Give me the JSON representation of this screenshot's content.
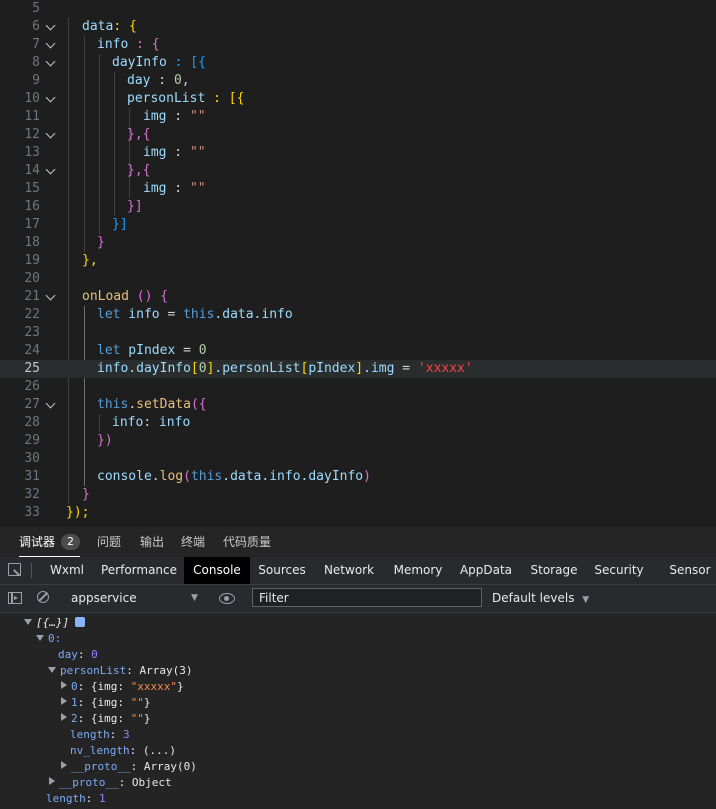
{
  "editor": {
    "lines": [
      {
        "n": "5"
      },
      {
        "n": "6"
      },
      {
        "n": "7"
      },
      {
        "n": "8"
      },
      {
        "n": "9"
      },
      {
        "n": "10"
      },
      {
        "n": "11"
      },
      {
        "n": "12"
      },
      {
        "n": "13"
      },
      {
        "n": "14"
      },
      {
        "n": "15"
      },
      {
        "n": "16"
      },
      {
        "n": "17"
      },
      {
        "n": "18"
      },
      {
        "n": "19"
      },
      {
        "n": "20"
      },
      {
        "n": "21"
      },
      {
        "n": "22"
      },
      {
        "n": "23"
      },
      {
        "n": "24"
      },
      {
        "n": "25"
      },
      {
        "n": "26"
      },
      {
        "n": "27"
      },
      {
        "n": "28"
      },
      {
        "n": "29"
      },
      {
        "n": "30"
      },
      {
        "n": "31"
      },
      {
        "n": "32"
      },
      {
        "n": "33"
      }
    ],
    "current_line": "25",
    "code": {
      "l6": [
        "data",
        ": {"
      ],
      "l7": [
        "info",
        " : {"
      ],
      "l8": [
        "dayInfo",
        " : [{"
      ],
      "l9": [
        "day",
        " : ",
        "0",
        ","
      ],
      "l10": [
        "personList",
        " : [{"
      ],
      "l11": [
        "img",
        " : ",
        "\"\""
      ],
      "l12": [
        "},{"
      ],
      "l13": [
        "img",
        " : ",
        "\"\""
      ],
      "l14": [
        "},{"
      ],
      "l15": [
        "img",
        " : ",
        "\"\""
      ],
      "l16": [
        "}]"
      ],
      "l17": [
        "}]"
      ],
      "l18": [
        "}"
      ],
      "l19": [
        "},"
      ],
      "l21": [
        "onLoad",
        " () {"
      ],
      "l22": [
        "let",
        " info",
        " = ",
        "this",
        ".data.info"
      ],
      "l24": [
        "let",
        " pIndex",
        " = ",
        "0"
      ],
      "l25": [
        "info.dayInfo",
        "[",
        "0",
        "]",
        ".personList",
        "[",
        "pIndex",
        "]",
        ".img",
        " = ",
        "'xxxxx'"
      ],
      "l27": [
        "this",
        ".",
        "setData",
        "({"
      ],
      "l28": [
        "info",
        ": info"
      ],
      "l29": [
        "})"
      ],
      "l31": [
        "console",
        ".",
        "log",
        "(",
        "this",
        ".data.info.dayInfo",
        ")"
      ],
      "l32": [
        "}"
      ],
      "l33": [
        "});"
      ]
    }
  },
  "panel_tabs": {
    "debugger": "调试器",
    "debugger_badge": "2",
    "problems": "问题",
    "output": "输出",
    "terminal": "终端",
    "code_quality": "代码质量"
  },
  "devtools_tabs": [
    "Wxml",
    "Performance",
    "Console",
    "Sources",
    "Network",
    "Memory",
    "AppData",
    "Storage",
    "Security",
    "Sensor"
  ],
  "devtools_active_tab": "Console",
  "toolbar": {
    "context": "appservice",
    "filter_placeholder": "Filter",
    "levels": "Default levels"
  },
  "console": {
    "root": "[{…}]",
    "item0": "0:",
    "day_key": "day",
    "day_val": "0",
    "personList_key": "personList",
    "personList_val": "Array(3)",
    "p0_key": "0",
    "p0_pre": "{img: ",
    "p0_val": "\"xxxxx\"",
    "p0_post": "}",
    "p1_key": "1",
    "p1_pre": "{img: ",
    "p1_val": "\"\"",
    "p1_post": "}",
    "p2_key": "2",
    "p2_pre": "{img: ",
    "p2_val": "\"\"",
    "p2_post": "}",
    "length_key": "length",
    "length_val": "3",
    "nvlength_key": "nv_length",
    "nvlength_val": "(...)",
    "proto_key": "__proto__",
    "proto_val": "Array(0)",
    "proto2_key": "__proto__",
    "proto2_val": "Object",
    "root_length_key": "length",
    "root_length_val": "1"
  }
}
